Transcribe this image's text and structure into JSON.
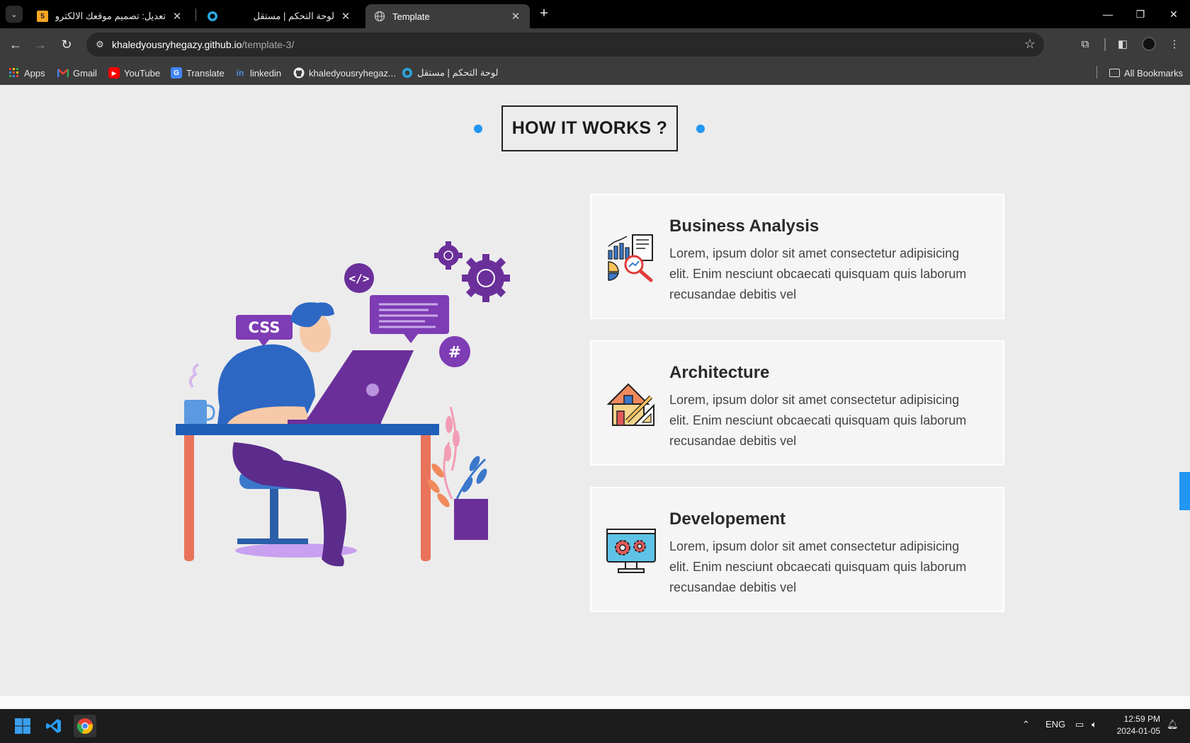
{
  "browser": {
    "tabs": [
      {
        "title": "تعديل: تصميم موقعك الالكتروني",
        "favicon": "tab-favicon-5",
        "favicon_label": "5",
        "active": false
      },
      {
        "title": "لوحة التحكم | مستقل",
        "favicon": "mostaql-icon",
        "active": false
      },
      {
        "title": "Template",
        "favicon": "globe-icon",
        "active": true
      }
    ],
    "new_tab_label": "+",
    "url_host": "khaledyousryhegazy.github.io",
    "url_path": "/template-3/",
    "bookmarks": [
      {
        "label": "Apps",
        "icon": "apps-grid-icon"
      },
      {
        "label": "Gmail",
        "icon": "gmail-icon"
      },
      {
        "label": "YouTube",
        "icon": "youtube-icon"
      },
      {
        "label": "Translate",
        "icon": "translate-icon"
      },
      {
        "label": "linkedin",
        "icon": "linkedin-icon"
      },
      {
        "label": "khaledyousryhegaz...",
        "icon": "github-icon"
      },
      {
        "label": "لوحة التحكم | مستقل",
        "icon": "mostaql-icon"
      }
    ],
    "all_bookmarks_label": "All Bookmarks"
  },
  "page": {
    "section_title": "HOW IT WORKS ?",
    "illustration": {
      "css_label": "CSS",
      "hash_label": "#",
      "code_label": "</>"
    },
    "cards": [
      {
        "title": "Business Analysis",
        "text": "Lorem, ipsum dolor sit amet consectetur adipisicing elit. Enim nesciunt obcaecati quisquam quis laborum recusandae debitis vel",
        "icon": "business-analysis-icon"
      },
      {
        "title": "Architecture",
        "text": "Lorem, ipsum dolor sit amet consectetur adipisicing elit. Enim nesciunt obcaecati quisquam quis laborum recusandae debitis vel",
        "icon": "architecture-icon"
      },
      {
        "title": "Developement",
        "text": "Lorem, ipsum dolor sit amet consectetur adipisicing elit. Enim nesciunt obcaecati quisquam quis laborum recusandae debitis vel",
        "icon": "development-icon"
      }
    ],
    "accent_color": "#2196f3"
  },
  "taskbar": {
    "language": "ENG",
    "time": "12:59 PM",
    "date": "2024-01-05"
  }
}
